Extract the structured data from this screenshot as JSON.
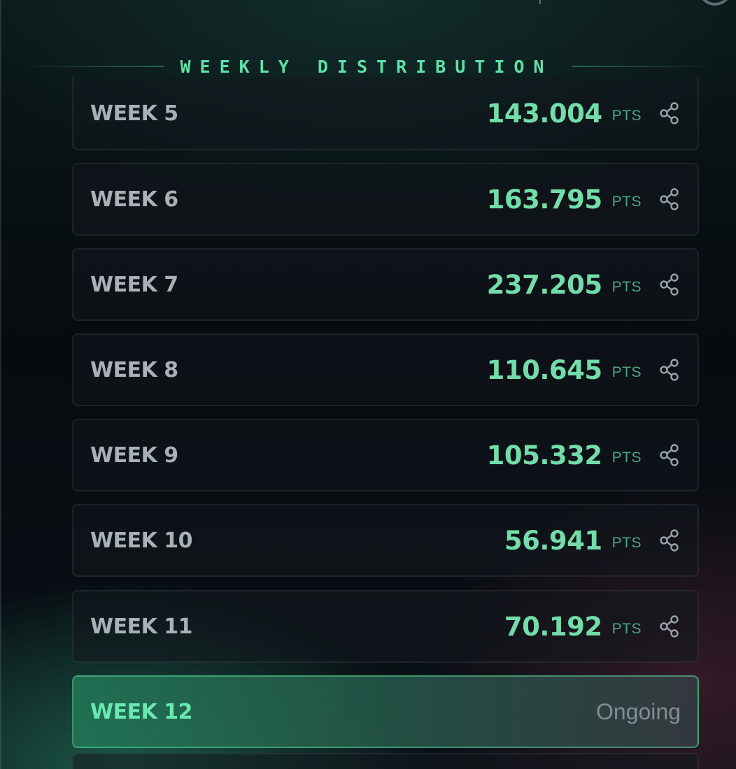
{
  "section": {
    "title": "WEEKLY DISTRIBUTION"
  },
  "weeks": [
    {
      "label": "WEEK 5",
      "value": "143.004",
      "unit": "PTS"
    },
    {
      "label": "WEEK 6",
      "value": "163.795",
      "unit": "PTS"
    },
    {
      "label": "WEEK 7",
      "value": "237.205",
      "unit": "PTS"
    },
    {
      "label": "WEEK 8",
      "value": "110.645",
      "unit": "PTS"
    },
    {
      "label": "WEEK 9",
      "value": "105.332",
      "unit": "PTS"
    },
    {
      "label": "WEEK 10",
      "value": "56.941",
      "unit": "PTS"
    },
    {
      "label": "WEEK 11",
      "value": "70.192",
      "unit": "PTS"
    }
  ],
  "current_week": {
    "label": "WEEK 12",
    "status": "Ongoing"
  },
  "icons": {
    "share": "share-icon"
  },
  "colors": {
    "accent": "#5fe0a8",
    "value": "#74dcaa",
    "label": "#a8b0b8",
    "status": "#838d94"
  }
}
